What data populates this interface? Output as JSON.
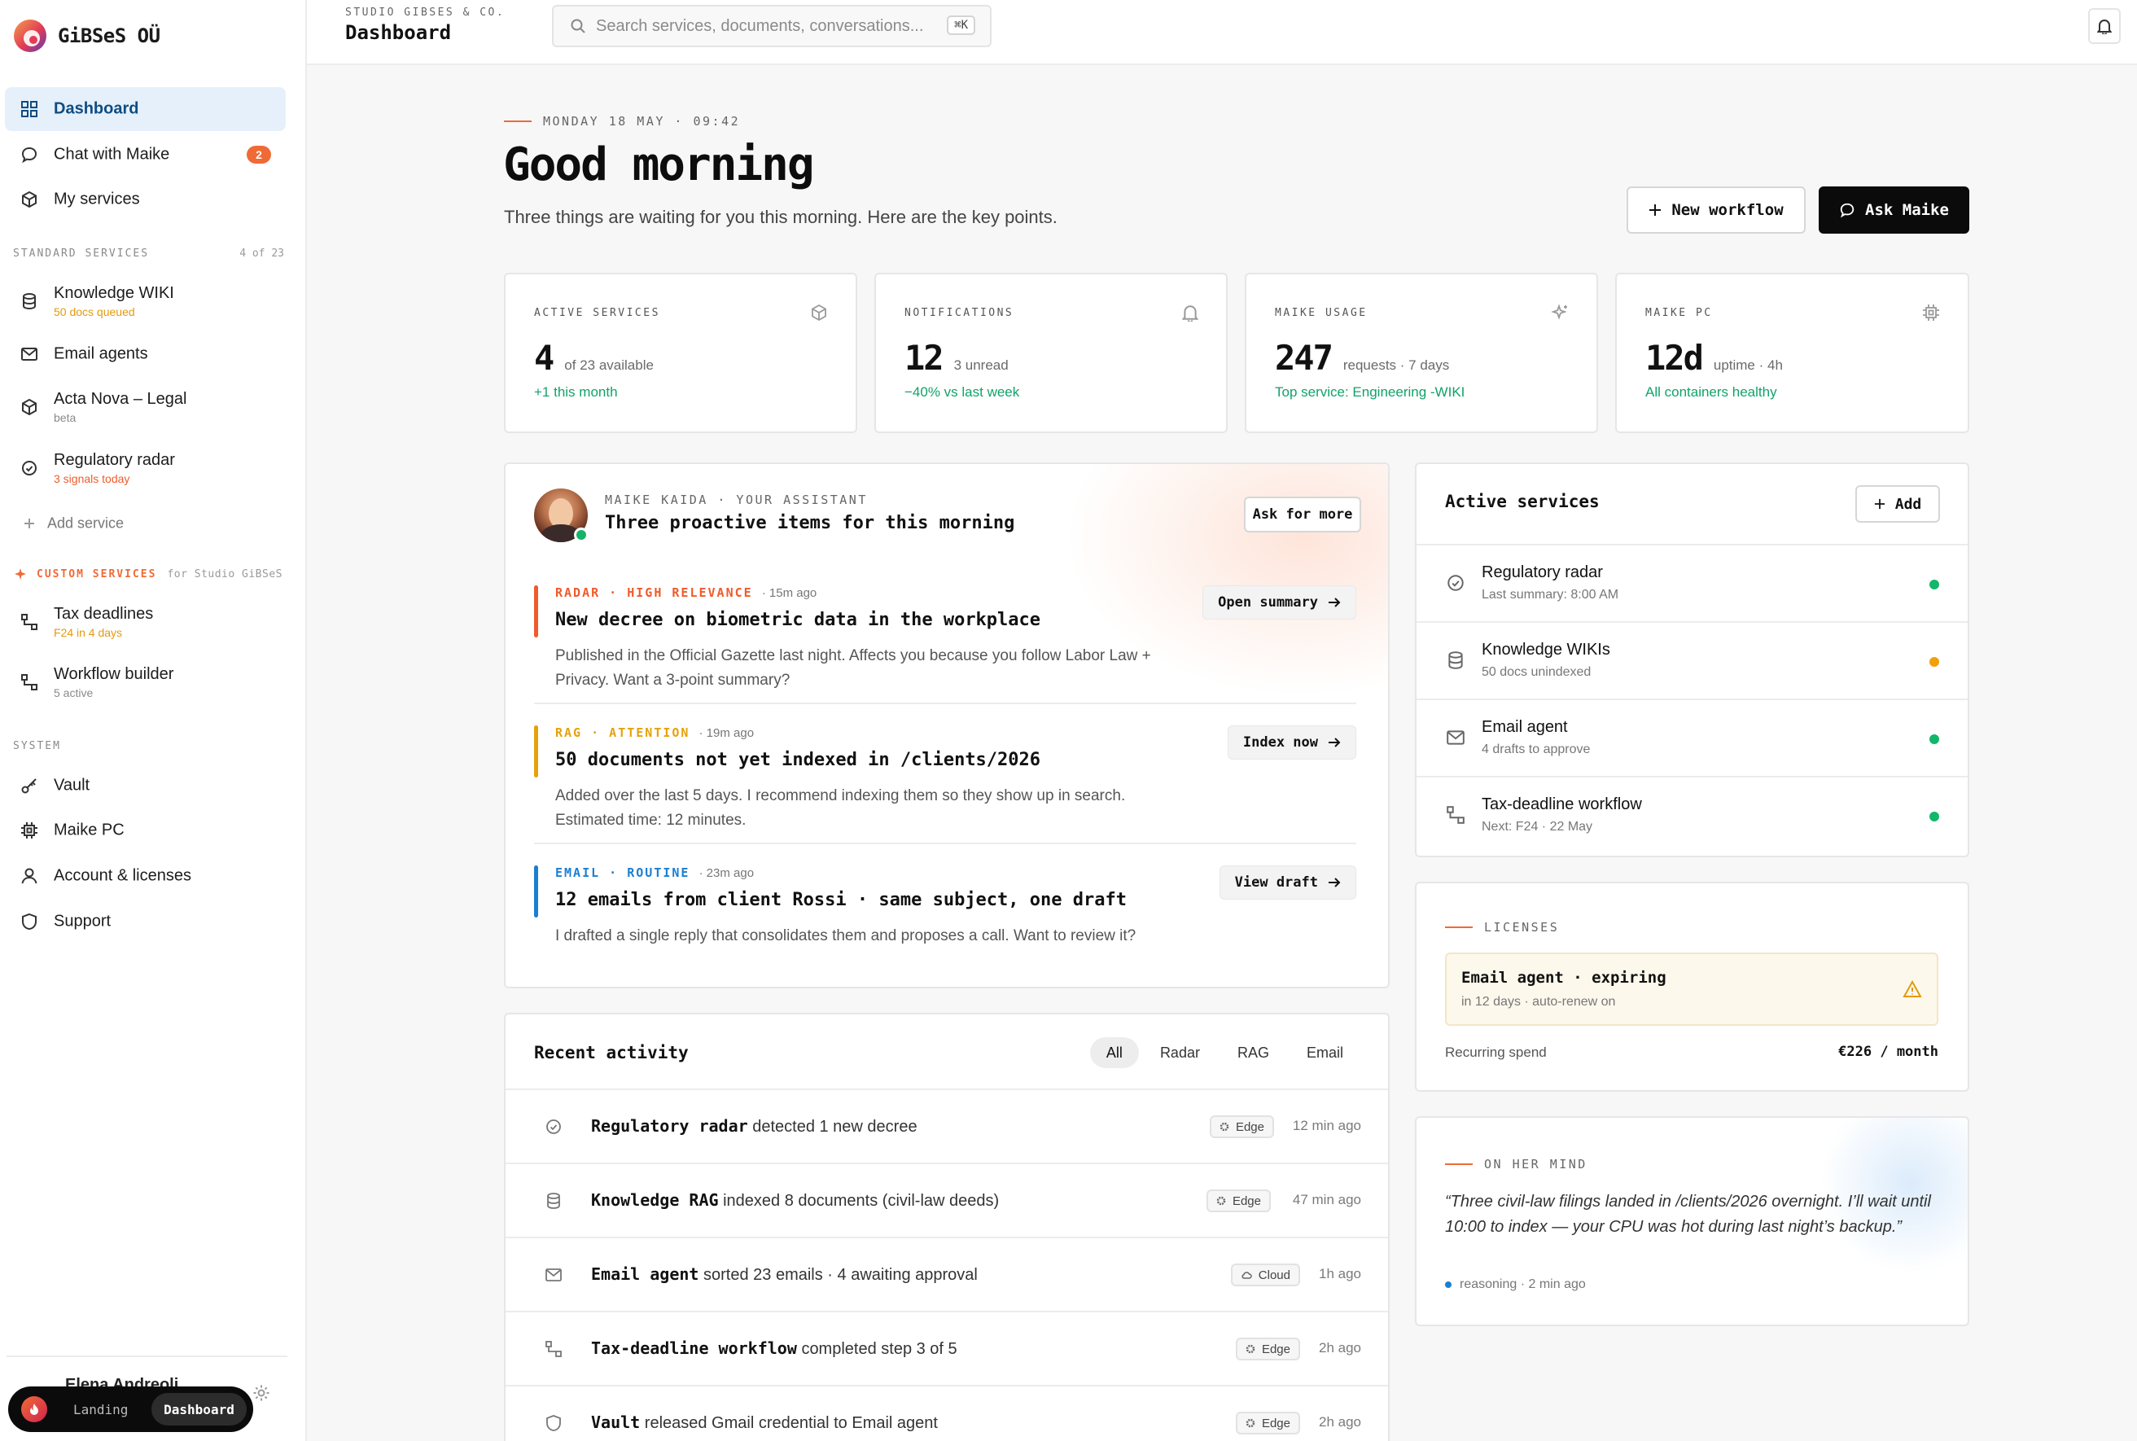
{
  "brand": {
    "name": "GiBSeS OÜ"
  },
  "sidebar": {
    "main_items": [
      {
        "label": "Dashboard",
        "icon": "grid-icon"
      },
      {
        "label": "Chat with Maike",
        "icon": "chat-bubble-icon",
        "badge": "2"
      },
      {
        "label": "My services",
        "icon": "cube-icon"
      }
    ],
    "standard_header": "STANDARD SERVICES",
    "standard_count": "4 of 23",
    "standard_items": [
      {
        "label": "Knowledge WIKI",
        "sub": "50 docs queued",
        "sub_color": "#e39a0b",
        "icon": "database-icon"
      },
      {
        "label": "Email agents",
        "sub": "",
        "icon": "mail-icon"
      },
      {
        "label": "Acta Nova – Legal",
        "sub": "beta",
        "sub_color": "#8a8a8a",
        "icon": "cube-icon"
      },
      {
        "label": "Regulatory radar",
        "sub": "3 signals today",
        "sub_color": "#ef5b2b",
        "icon": "radar-icon"
      }
    ],
    "add_service": "Add service",
    "custom_header": "CUSTOM SERVICES",
    "custom_note": "for Studio GiBSeS",
    "custom_items": [
      {
        "label": "Tax deadlines",
        "sub": "F24 in 4 days",
        "sub_color": "#e39a0b",
        "icon": "workflow-icon"
      },
      {
        "label": "Workflow builder",
        "sub": "5 active",
        "sub_color": "#8a8a8a",
        "icon": "workflow-icon"
      }
    ],
    "system_header": "SYSTEM",
    "system_items": [
      {
        "label": "Vault",
        "icon": "key-icon"
      },
      {
        "label": "Maike PC",
        "icon": "chip-icon"
      },
      {
        "label": "Account & licenses",
        "icon": "user-icon"
      },
      {
        "label": "Support",
        "icon": "shield-icon"
      }
    ],
    "user_name": "Elena Andreoli",
    "switch": {
      "landing": "Landing",
      "dashboard": "Dashboard"
    }
  },
  "topbar": {
    "org": "STUDIO GIBSES & CO.",
    "title": "Dashboard",
    "search_placeholder": "Search services, documents, conversations...",
    "shortcut": "⌘K"
  },
  "greeting": {
    "date": "MONDAY 18 MAY · 09:42",
    "title": "Good morning",
    "subtitle": "Three things are waiting for you this morning. Here are the key points.",
    "new_workflow": "New workflow",
    "ask_maike": "Ask Maike"
  },
  "stats": [
    {
      "label": "ACTIVE SERVICES",
      "value": "4",
      "unit": "of 23 available",
      "delta": "+1 this month",
      "icon": "cube-icon"
    },
    {
      "label": "NOTIFICATIONS",
      "value": "12",
      "unit": "3 unread",
      "delta": "−40% vs last week",
      "icon": "bell-icon"
    },
    {
      "label": "MAIKE USAGE",
      "value": "247",
      "unit": "requests · 7 days",
      "delta": "Top service: Engineering -WIKI",
      "icon": "sparkle-icon"
    },
    {
      "label": "MAIKE PC",
      "value": "12d",
      "unit": "uptime · 4h",
      "delta": "All containers healthy",
      "icon": "chip-icon"
    }
  ],
  "proactive": {
    "who": "MAIKE KAIDA · YOUR ASSISTANT",
    "title": "Three proactive items for this morning",
    "ask_more": "Ask for more",
    "items": [
      {
        "tag": "RADAR · HIGH RELEVANCE",
        "ago": "· 15m ago",
        "color": "#ef5b2b",
        "title": "New decree on biometric data in the workplace",
        "desc": "Published in the Official Gazette last night. Affects you because you follow Labor Law + Privacy. Want a 3-point summary?",
        "action": "Open summary"
      },
      {
        "tag": "RAG · ATTENTION",
        "ago": "· 19m ago",
        "color": "#e6a10a",
        "title": "50 documents not yet indexed in /clients/2026",
        "desc": "Added over the last 5 days. I recommend indexing them so they show up in search. Estimated time: 12 minutes.",
        "action": "Index now"
      },
      {
        "tag": "EMAIL · ROUTINE",
        "ago": "· 23m ago",
        "color": "#1a7fd1",
        "title": "12 emails from client Rossi · same subject, one draft",
        "desc": "I drafted a single reply that consolidates them and proposes a call. Want to review it?",
        "action": "View draft"
      }
    ]
  },
  "activity": {
    "title": "Recent activity",
    "filters": [
      "All",
      "Radar",
      "RAG",
      "Email"
    ],
    "rows": [
      {
        "icon": "radar-icon",
        "name": "Regulatory radar",
        "text": "detected 1 new decree",
        "pill": "Edge",
        "pill_icon": "gear-icon",
        "time": "12 min ago"
      },
      {
        "icon": "database-icon",
        "name": "Knowledge RAG",
        "text": "indexed 8 documents (civil-law deeds)",
        "pill": "Edge",
        "pill_icon": "gear-icon",
        "time": "47 min ago"
      },
      {
        "icon": "mail-icon",
        "name": "Email agent",
        "text": "sorted 23 emails · 4 awaiting approval",
        "pill": "Cloud",
        "pill_icon": "cloud-icon",
        "time": "1h ago"
      },
      {
        "icon": "workflow-icon",
        "name": "Tax-deadline workflow",
        "text": "completed step 3 of 5",
        "pill": "Edge",
        "pill_icon": "gear-icon",
        "time": "2h ago"
      },
      {
        "icon": "shield-icon",
        "name": "Vault",
        "text": "released Gmail credential to Email agent",
        "pill": "Edge",
        "pill_icon": "gear-icon",
        "time": "2h ago"
      }
    ]
  },
  "active_services": {
    "title": "Active services",
    "add": "Add",
    "items": [
      {
        "icon": "radar-icon",
        "name": "Regulatory radar",
        "sub": "Last summary: 8:00 AM",
        "status": "#12b76a"
      },
      {
        "icon": "database-icon",
        "name": "Knowledge WIKIs",
        "sub": "50 docs unindexed",
        "status": "#f0a00b"
      },
      {
        "icon": "mail-icon",
        "name": "Email agent",
        "sub": "4 drafts to approve",
        "status": "#12b76a"
      },
      {
        "icon": "workflow-icon",
        "name": "Tax-deadline workflow",
        "sub": "Next: F24 · 22 May",
        "status": "#12b76a"
      }
    ]
  },
  "licenses": {
    "label": "LICENSES",
    "alert_title": "Email agent · expiring",
    "alert_sub": "in 12 days · auto-renew on",
    "spend_label": "Recurring spend",
    "spend_value": "€226 / month"
  },
  "mind": {
    "label": "ON HER MIND",
    "quote": "“Three civil-law filings landed in /clients/2026 overnight. I’ll wait until 10:00 to index — your CPU was hot during last night’s backup.”",
    "meta": "reasoning · 2 min ago"
  },
  "colors": {
    "accent": "#f06a35",
    "brand_blue": "#0f4c81",
    "success": "#10a36a"
  }
}
